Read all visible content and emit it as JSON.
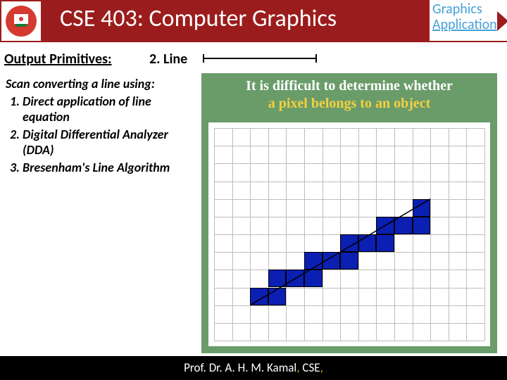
{
  "header": {
    "title": "CSE 403: Computer Graphics",
    "corner_line1": "Graphics",
    "corner_line2": "Application"
  },
  "section": {
    "heading": "Output Primitives:",
    "subheading": "2. Line"
  },
  "body": {
    "intro": "Scan converting a line using:",
    "methods": [
      "Direct application of line equation",
      "Digital Differential Analyzer (DDA)",
      "Bresenham's Line Algorithm"
    ]
  },
  "figure": {
    "caption_part1": "It is difficult to determine whether",
    "caption_part2": "a pixel belongs to an object",
    "grid": {
      "cols": 15,
      "rows": 12
    },
    "pixels": [
      {
        "c": 2,
        "r": 9
      },
      {
        "c": 3,
        "r": 9
      },
      {
        "c": 3,
        "r": 8
      },
      {
        "c": 4,
        "r": 8
      },
      {
        "c": 5,
        "r": 8
      },
      {
        "c": 5,
        "r": 7
      },
      {
        "c": 6,
        "r": 7
      },
      {
        "c": 7,
        "r": 7
      },
      {
        "c": 7,
        "r": 6
      },
      {
        "c": 8,
        "r": 6
      },
      {
        "c": 9,
        "r": 6
      },
      {
        "c": 9,
        "r": 5
      },
      {
        "c": 10,
        "r": 5
      },
      {
        "c": 11,
        "r": 5
      },
      {
        "c": 11,
        "r": 4
      }
    ],
    "line": {
      "x1_col": 2,
      "y1_row": 10,
      "x2_col": 12,
      "y2_row": 4
    }
  },
  "footer": {
    "author": "Prof. Dr. A. H. M. Kamal",
    "dept": "CSE"
  }
}
